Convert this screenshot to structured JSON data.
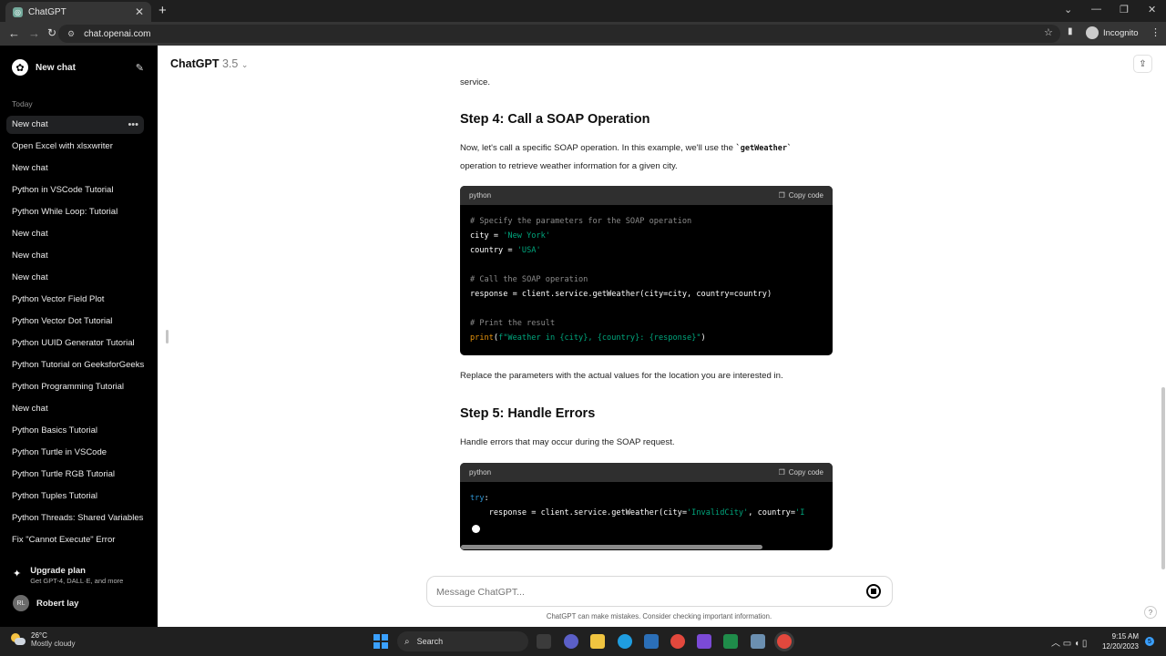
{
  "browser": {
    "tab_title": "ChatGPT",
    "tab_close": "✕",
    "new_tab": "+",
    "url": "chat.openai.com",
    "profile": "Incognito"
  },
  "sidebar": {
    "new_chat": "New chat",
    "section_today": "Today",
    "items": [
      {
        "label": "New chat",
        "active": true
      },
      {
        "label": "Open Excel with xlsxwriter"
      },
      {
        "label": "New chat"
      },
      {
        "label": "Python in VSCode Tutorial"
      },
      {
        "label": "Python While Loop: Tutorial"
      },
      {
        "label": "New chat"
      },
      {
        "label": "New chat"
      },
      {
        "label": "New chat"
      },
      {
        "label": "Python Vector Field Plot"
      },
      {
        "label": "Python Vector Dot Tutorial"
      },
      {
        "label": "Python UUID Generator Tutorial"
      },
      {
        "label": "Python Tutorial on GeeksforGeeks"
      },
      {
        "label": "Python Programming Tutorial"
      },
      {
        "label": "New chat"
      },
      {
        "label": "Python Basics Tutorial"
      },
      {
        "label": "Python Turtle in VSCode"
      },
      {
        "label": "Python Turtle RGB Tutorial"
      },
      {
        "label": "Python Tuples Tutorial"
      },
      {
        "label": "Python Threads: Shared Variables"
      },
      {
        "label": "Fix \"Cannot Execute\" Error"
      }
    ],
    "upgrade_title": "Upgrade plan",
    "upgrade_sub": "Get GPT-4, DALL·E, and more",
    "user_initials": "RL",
    "user_name": "Robert lay"
  },
  "header": {
    "model": "ChatGPT",
    "version": "3.5"
  },
  "content": {
    "prev_tail": "service.",
    "step4_title": "Step 4: Call a SOAP Operation",
    "step4_p_a": "Now, let's call a specific SOAP operation. In this example, we'll use the ",
    "step4_code_inline": "`getWeather`",
    "step4_p_b": "operation to retrieve weather information for a given city.",
    "code1_lang": "python",
    "copy_label": "Copy code",
    "code1": {
      "c1": "# Specify the parameters for the SOAP operation",
      "l_city": "city = ",
      "v_city": "'New York'",
      "l_country": "country = ",
      "v_country": "'USA'",
      "c2": "# Call the SOAP operation",
      "l_resp": "response = client.service.getWeather(city=city, country=country)",
      "c3": "# Print the result",
      "print_fn": "print",
      "print_open": "(",
      "print_str": "f\"Weather in {city}, {country}: {response}\"",
      "print_close": ")"
    },
    "step4_after": "Replace the parameters with the actual values for the location you are interested in.",
    "step5_title": "Step 5: Handle Errors",
    "step5_p": "Handle errors that may occur during the SOAP request.",
    "code2_lang": "python",
    "code2": {
      "kw_try": "try",
      "colon": ":",
      "l2a": "    response = client.service.getWeather(city=",
      "l2s": "'InvalidCity'",
      "l2b": ", country=",
      "l2t": "'I"
    }
  },
  "composer": {
    "placeholder": "Message ChatGPT..."
  },
  "disclaimer": "ChatGPT can make mistakes. Consider checking important information.",
  "taskbar": {
    "temp": "26°C",
    "weather": "Mostly cloudy",
    "search": "Search",
    "time": "9:15 AM",
    "date": "12/20/2023",
    "notif_count": "5"
  },
  "colors": {
    "sidebar_bg": "#000000",
    "code_string": "#00a67d",
    "code_comment": "#8b8b8b",
    "code_keyword": "#2e95d3"
  }
}
